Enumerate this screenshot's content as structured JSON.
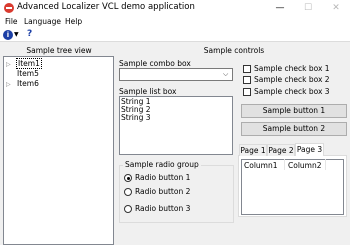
{
  "window": {
    "title": "Advanced Localizer VCL demo application",
    "minimize": "—",
    "maximize": "☐",
    "close": "✕"
  },
  "menu": [
    "File",
    "Language",
    "Help"
  ],
  "toolbar": {
    "info_glyph": "i",
    "dropdown_glyph": "▼",
    "help_glyph": "?"
  },
  "tree": {
    "header": "Sample tree view",
    "items": [
      {
        "label": "Item1",
        "selected": true
      },
      {
        "label": "Item5",
        "selected": false
      },
      {
        "label": "Item6",
        "selected": false
      }
    ]
  },
  "controls": {
    "header": "Sample controls",
    "combo": {
      "label": "Sample combo box",
      "value": ""
    },
    "list": {
      "label": "Sample list box",
      "items": [
        "String 1",
        "String 2",
        "String 3"
      ]
    },
    "radio_group": {
      "label": "Sample radio group",
      "items": [
        {
          "label": "Radio button 1",
          "checked": true
        },
        {
          "label": "Radio button 2",
          "checked": false
        },
        {
          "label": "Radio button 3",
          "checked": false
        }
      ]
    },
    "checkboxes": [
      {
        "label": "Sample check box 1",
        "checked": false
      },
      {
        "label": "Sample check box 2",
        "checked": false
      },
      {
        "label": "Sample check box 3",
        "checked": false
      }
    ],
    "buttons": [
      "Sample button 1",
      "Sample button 2"
    ],
    "tabs": [
      {
        "label": "Page 1",
        "active": false
      },
      {
        "label": "Page 2",
        "active": false
      },
      {
        "label": "Page 3",
        "active": true
      }
    ],
    "listview_columns": [
      "Column1",
      "Column2"
    ]
  }
}
